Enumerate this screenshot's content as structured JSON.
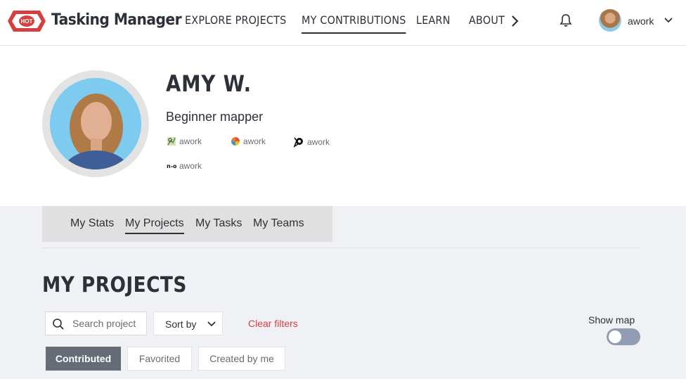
{
  "header": {
    "brand": "Tasking Manager",
    "logo_text": "HOT",
    "nav": [
      "EXPLORE PROJECTS",
      "MY CONTRIBUTIONS",
      "LEARN",
      "ABOUT"
    ],
    "active_nav": "MY CONTRIBUTIONS",
    "user": "awork",
    "icons": [
      "chevron-right-icon",
      "bell-icon",
      "chevron-down-icon"
    ]
  },
  "profile": {
    "name": "AMY W.",
    "level": "Beginner mapper",
    "accounts": [
      {
        "service": "osm",
        "icon": "osm-icon",
        "username": "awork"
      },
      {
        "service": "osmcha",
        "icon": "osmcha-icon",
        "username": "awork"
      },
      {
        "service": "hdyc",
        "icon": "hdyc-icon",
        "username": "awork"
      },
      {
        "service": "ohsome",
        "icon": "ohsome-icon",
        "username": "awork"
      }
    ]
  },
  "tabs": {
    "items": [
      "My Stats",
      "My Projects",
      "My Tasks",
      "My Teams"
    ],
    "active": "My Projects"
  },
  "projects": {
    "title": "MY PROJECTS",
    "search_placeholder": "Search project",
    "sort_label": "Sort by",
    "clear_filters": "Clear filters",
    "show_map_label": "Show map",
    "show_map_enabled": false,
    "filters": [
      "Contributed",
      "Favorited",
      "Created by me"
    ],
    "active_filter": "Contributed"
  },
  "colors": {
    "accent_red": "#d73f3f",
    "text_dark": "#2c3038",
    "active_filter_bg": "#666c75",
    "toggle_off_bg": "#929db3"
  }
}
